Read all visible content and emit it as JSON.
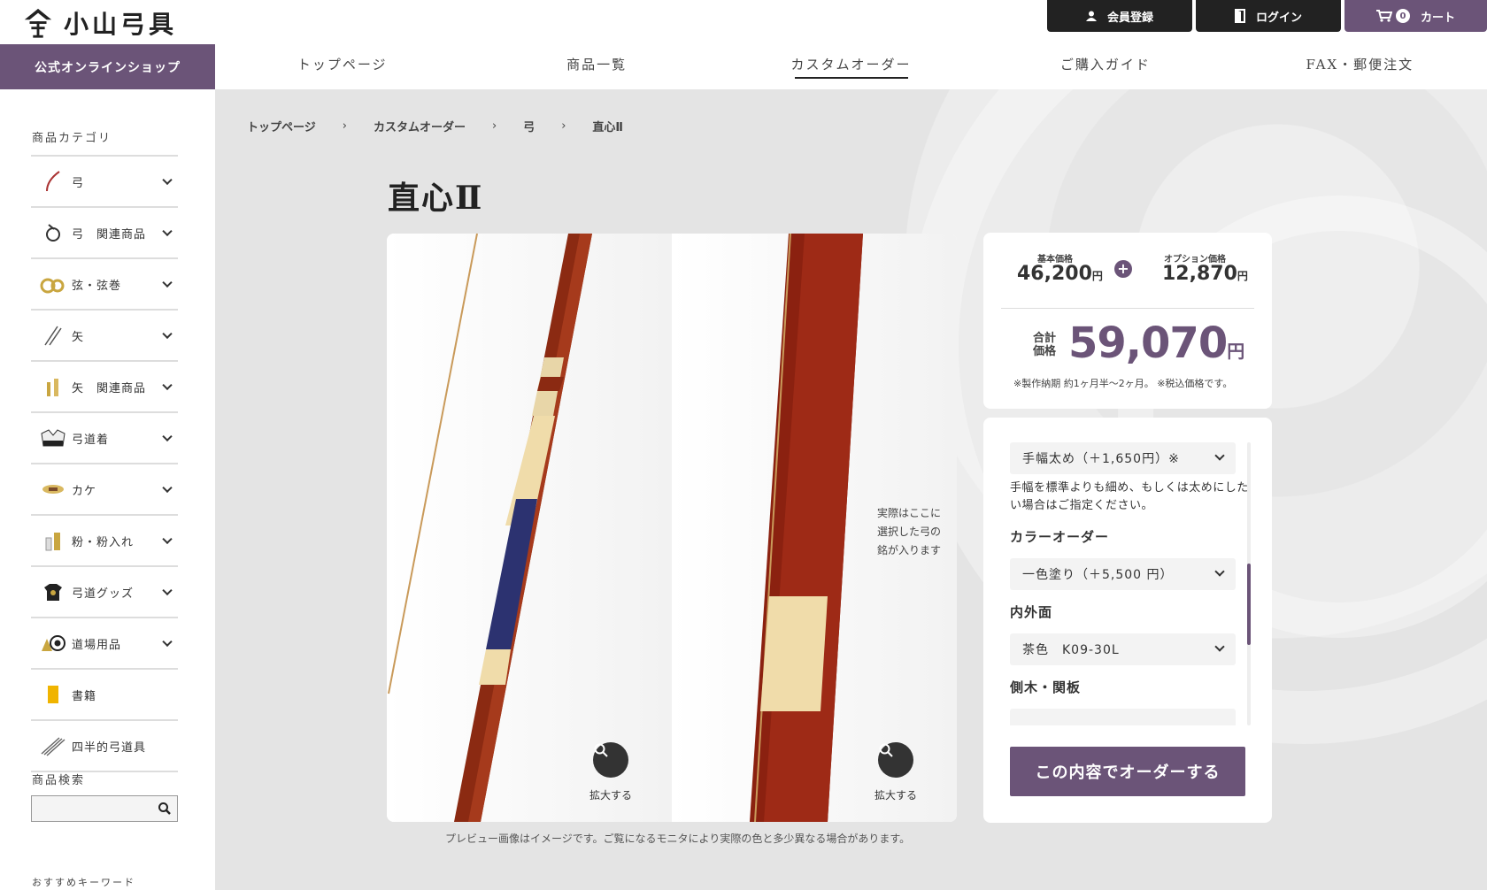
{
  "header": {
    "logo_text": "小山弓具",
    "shop_badge": "公式オンラインショップ",
    "top_buttons": {
      "register": "会員登録",
      "login": "ログイン",
      "cart": "カート",
      "cart_count": "0"
    },
    "nav": [
      {
        "label": "トップページ"
      },
      {
        "label": "商品一覧"
      },
      {
        "label": "カスタムオーダー"
      },
      {
        "label": "ご購入ガイド"
      },
      {
        "label": "FAX・郵便注文"
      }
    ]
  },
  "sidebar": {
    "category_title": "商品カテゴリ",
    "categories": [
      {
        "label": "弓",
        "icon": "bow-icon"
      },
      {
        "label": "弓　関連商品",
        "icon": "bow-accessory-icon"
      },
      {
        "label": "弦・弦巻",
        "icon": "string-icon"
      },
      {
        "label": "矢",
        "icon": "arrow-icon"
      },
      {
        "label": "矢　関連商品",
        "icon": "arrow-accessory-icon"
      },
      {
        "label": "弓道着",
        "icon": "uniform-icon"
      },
      {
        "label": "カケ",
        "icon": "glove-icon"
      },
      {
        "label": "粉・粉入れ",
        "icon": "powder-icon"
      },
      {
        "label": "弓道グッズ",
        "icon": "goods-icon"
      },
      {
        "label": "道場用品",
        "icon": "target-icon"
      },
      {
        "label": "書籍",
        "icon": "book-icon"
      },
      {
        "label": "四半的弓道具",
        "icon": "shihanmato-icon"
      }
    ],
    "search_title": "商品検索",
    "search_placeholder": "",
    "keywords_title": "おすすめキーワード"
  },
  "breadcrumb": [
    "トップページ",
    "カスタムオーダー",
    "弓",
    "直心Ⅱ"
  ],
  "product": {
    "title": "直心Ⅱ",
    "zoom_label_1": "拡大する",
    "zoom_label_2": "拡大する",
    "name_note": "実際はここに\n選択した弓の\n銘が入ります",
    "preview_note": "プレビュー画像はイメージです。ご覧になるモニタにより実際の色と多少異なる場合があります。"
  },
  "price": {
    "base_label": "基本価格",
    "base_value": "46,200",
    "base_unit": "円",
    "option_label": "オプション価格",
    "option_value": "12,870",
    "option_unit": "円",
    "total_label_1": "合計",
    "total_label_2": "価格",
    "total_value": "59,070",
    "total_unit": "円",
    "note": "※製作納期 約1ヶ月半〜2ヶ月。 ※税込価格です。"
  },
  "options": {
    "grip_select": "手幅太め（＋1,650円）※",
    "grip_help": "手幅を標準よりも細め、もしくは太めにしたい場合はご指定ください。",
    "color_heading": "カラーオーダー",
    "color_select": "一色塗り（＋5,500 円）",
    "inner_heading": "内外面",
    "inner_select": "茶色　K09-30L",
    "side_heading": "側木・関板",
    "order_button": "この内容でオーダーする"
  },
  "colors": {
    "brand": "#6b5478",
    "dark": "#222222",
    "bow": "#8b2a12"
  }
}
